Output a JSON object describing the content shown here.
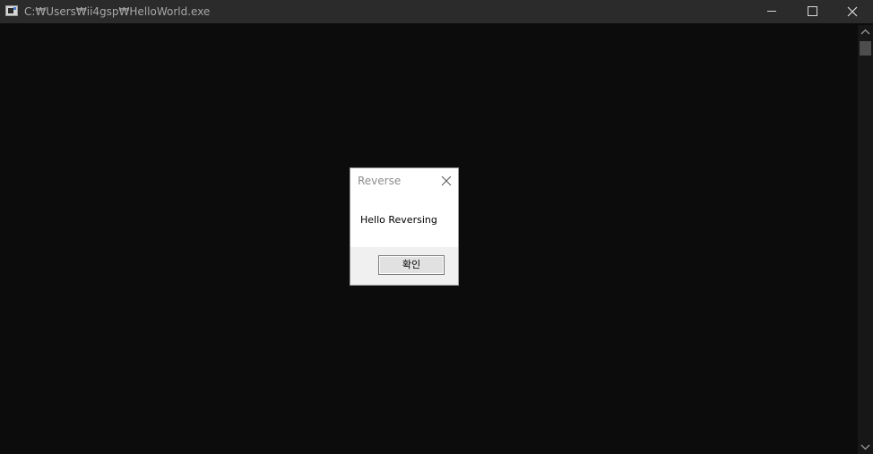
{
  "window": {
    "title": "C:₩Users₩ii4gsp₩HelloWorld.exe",
    "icons": {
      "app": "console-app-icon",
      "minimize": "minimize-icon",
      "maximize": "maximize-icon",
      "close": "close-icon"
    },
    "colors": {
      "titlebar": "#2b2b2b",
      "console_background": "#0c0c0c",
      "title_text": "#a8a8a8"
    }
  },
  "scrollbar": {
    "up_icon": "chevron-up-icon",
    "down_icon": "chevron-down-icon"
  },
  "dialog": {
    "title": "Reverse",
    "message": "Hello Reversing",
    "ok_label": "확인",
    "close_icon": "close-icon",
    "colors": {
      "background": "#ffffff",
      "footer": "#f0f0f0",
      "title_text": "#8c8c8c"
    }
  }
}
